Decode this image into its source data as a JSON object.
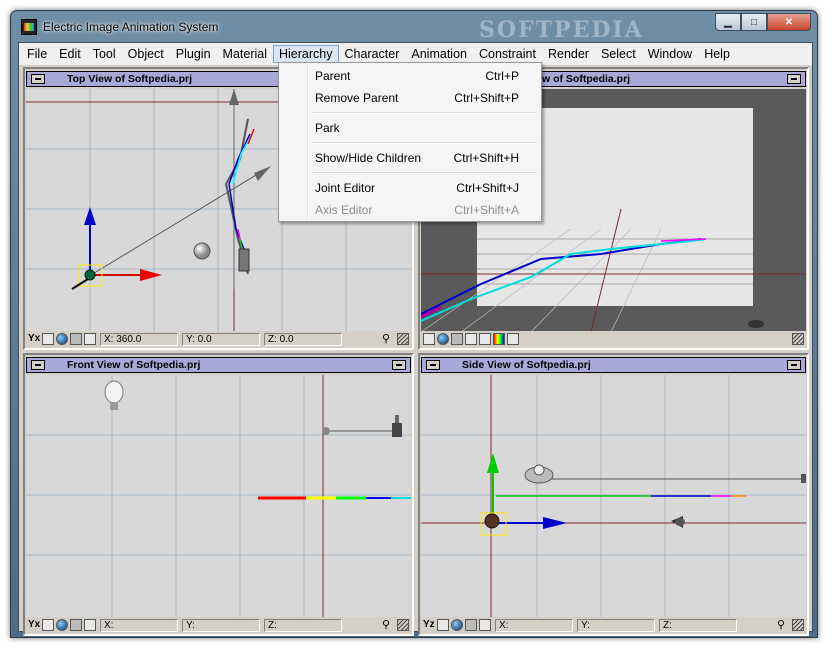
{
  "window": {
    "title": "Electric Image Animation System",
    "watermark": "SOFTPEDIA",
    "controls": {
      "minimize": "▁",
      "maximize": "□",
      "close": "✕"
    }
  },
  "menubar": {
    "items": [
      "File",
      "Edit",
      "Tool",
      "Object",
      "Plugin",
      "Material",
      "Hierarchy",
      "Character",
      "Animation",
      "Constraint",
      "Render",
      "Select",
      "Window",
      "Help"
    ],
    "active": "Hierarchy"
  },
  "hierarchy_menu": {
    "items": [
      {
        "label": "Parent",
        "shortcut": "Ctrl+P",
        "enabled": true
      },
      {
        "label": "Remove Parent",
        "shortcut": "Ctrl+Shift+P",
        "enabled": true
      },
      {
        "label": "Park",
        "shortcut": "",
        "enabled": true
      },
      {
        "label": "Show/Hide Children",
        "shortcut": "Ctrl+Shift+H",
        "enabled": true
      },
      {
        "label": "Joint Editor",
        "shortcut": "Ctrl+Shift+J",
        "enabled": true
      },
      {
        "label": "Axis Editor",
        "shortcut": "Ctrl+Shift+A",
        "enabled": false
      }
    ]
  },
  "viewports": {
    "top": {
      "title": "Top View of Softpedia.prj",
      "axis": "Yx",
      "x": "X: 360.0",
      "y": "Y: 0.0",
      "z": "Z: 0.0"
    },
    "camera": {
      "title_visible": "w of Softpedia.prj"
    },
    "front": {
      "title": "Front View of Softpedia.prj",
      "axis": "Yx",
      "x": "X:",
      "y": "Y:",
      "z": "Z:"
    },
    "side": {
      "title": "Side View of Softpedia.prj",
      "axis": "Yz",
      "x": "X:",
      "y": "Y:",
      "z": "Z:"
    }
  },
  "colors": {
    "title_bar": "#a9a9d9",
    "canvas": "#d8d8d8",
    "grid": "#9fb0c8",
    "axis_line": "#7a2a2a",
    "selection": "#ffe800"
  },
  "icons": {
    "zoom": "🔍",
    "zoom_glyph": "⚲"
  }
}
